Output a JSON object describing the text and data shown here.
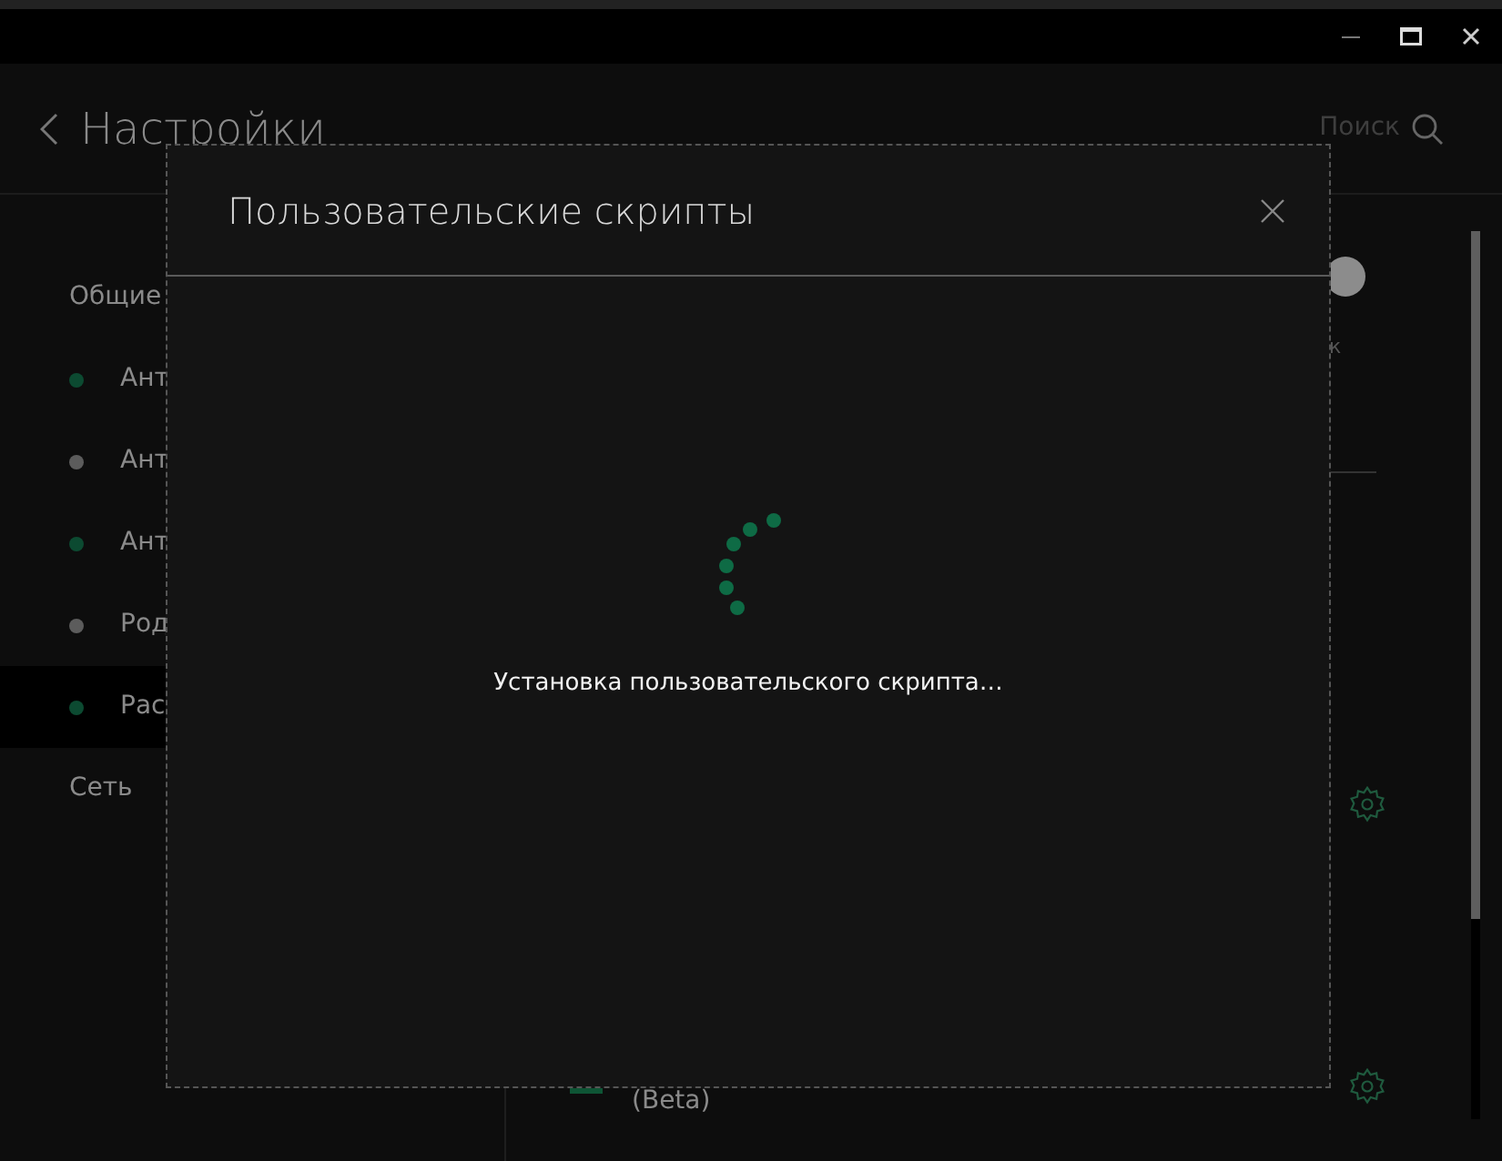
{
  "header": {
    "title": "Настройки",
    "search_label": "Поиск"
  },
  "sidebar": {
    "items": [
      {
        "kind": "heading",
        "label": "Общие"
      },
      {
        "kind": "item",
        "label": "Ант",
        "color": "#0c4a31",
        "selected": false
      },
      {
        "kind": "item",
        "label": "Ант",
        "color": "#5c5c5c",
        "selected": false
      },
      {
        "kind": "item",
        "label": "Ант",
        "color": "#0c4a31",
        "selected": false
      },
      {
        "kind": "item",
        "label": "Род",
        "color": "#5c5c5c",
        "selected": false
      },
      {
        "kind": "item",
        "label": "Рас",
        "color": "#0c4a31",
        "selected": true
      },
      {
        "kind": "heading",
        "label": "Сеть"
      }
    ]
  },
  "content": {
    "toggle": {
      "on": false
    },
    "fragment": "к",
    "beta_label": "(Beta)"
  },
  "modal": {
    "title": "Пользовательские скрипты",
    "message": "Установка пользовательского скрипта…"
  }
}
